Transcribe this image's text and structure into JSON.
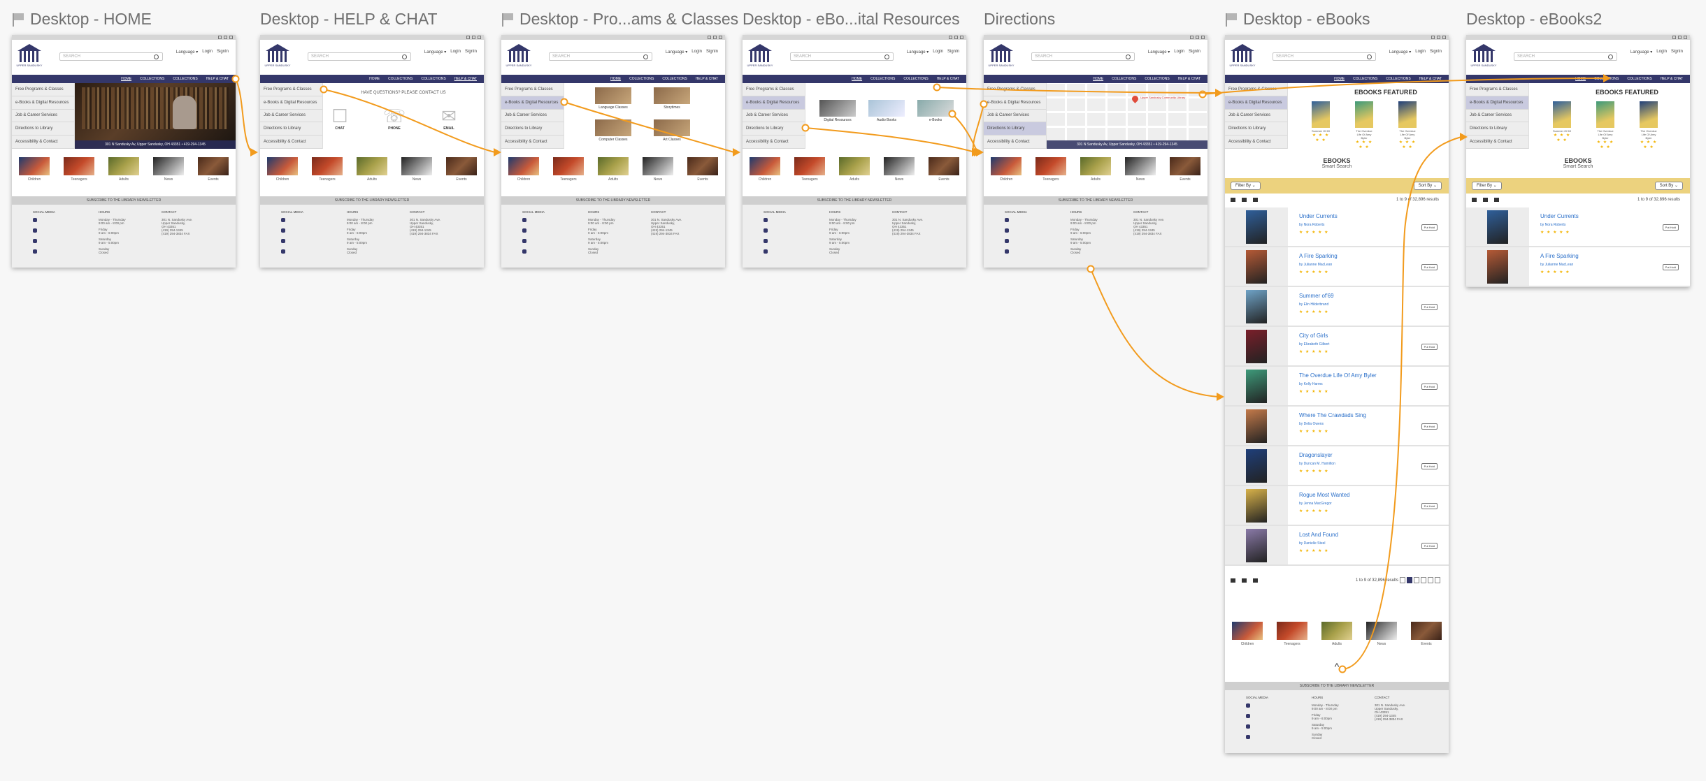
{
  "artboards": [
    {
      "title": "Desktop - HOME",
      "flag": true,
      "variant": "home",
      "active_nav": 0
    },
    {
      "title": "Desktop - HELP & CHAT",
      "flag": false,
      "variant": "help",
      "active_nav": 3
    },
    {
      "title": "Desktop - Pro...ams & Classes",
      "flag": true,
      "variant": "programs",
      "active_side": 1
    },
    {
      "title": "Desktop - eBo...ital Resources",
      "flag": false,
      "variant": "eresources",
      "active_side": 1
    },
    {
      "title": "Directions",
      "flag": false,
      "variant": "directions",
      "active_side": 3
    },
    {
      "title": "Desktop - eBooks",
      "flag": true,
      "variant": "ebooks",
      "active_side": 1
    },
    {
      "title": "Desktop - eBooks2",
      "flag": false,
      "variant": "ebooks2",
      "active_side": 1
    }
  ],
  "header": {
    "search_placeholder": "SEARCH",
    "language": "Language ▾",
    "login": "Login",
    "signin": "SignIn",
    "logo_text": "UPPER SANDUSKY"
  },
  "nav": [
    "HOME",
    "COLLECTIONS",
    "COLLECTIONS",
    "HELP & CHAT"
  ],
  "sidebar": [
    "Free Programs & Classes",
    "e-Books & Digital Resources",
    "Job & Career Services",
    "Directions to Library",
    "Accessibility & Contact"
  ],
  "address": "301 N Sandusky Av, Upper Sandusky, OH 43351 • 419-294-1345",
  "help": {
    "heading": "HAVE QUESTIONS? PLEASE CONTACT US",
    "options": [
      "CHAT",
      "PHONE",
      "EMAIL"
    ]
  },
  "programs": [
    "Language Classes",
    "Storytimes",
    "Computer Classes",
    "Art Classes"
  ],
  "eresources": [
    "Digital Resources",
    "Audio Books",
    "e-Books"
  ],
  "map_label": "Upper Sandusky Community Library",
  "categories": [
    "Children",
    "Teenagers",
    "Adults",
    "News",
    "Events"
  ],
  "subscribe": "SUBSCRIBE TO THE LIBRARY NEWSLETTER",
  "footer": {
    "social": "SOCIAL MEDIA",
    "hours": "HOURS",
    "contact": "CONTACT",
    "hours_lines": [
      "Monday - Thursday",
      "9:00 am - 8:00 pm",
      "Friday",
      "9 am - 6:00pm",
      "Saturday",
      "9 am - 5:00pm",
      "Sunday",
      "Closed"
    ],
    "contact_lines": [
      "301 N. Sandusky Ave.",
      "Upper Sandusky,",
      "OH 43351",
      "(419) 294-1345",
      "(419) 294-3834 FAX"
    ]
  },
  "ebooks": {
    "featured_heading": "EBOOKS FEATURED",
    "featured": [
      {
        "title": "Summer Of 69"
      },
      {
        "title": "The Overdue Life Of Amy Byler"
      },
      {
        "title": "The Overdue Life Of Amy Byler"
      }
    ],
    "smart_title": "EBOOKS",
    "smart_sub": "Smart Search",
    "filter_by": "Filter By ⌄",
    "sort_by": "Sort By ⌄",
    "results": "1 to 9 of 32,896 results",
    "hold": "Put Hold",
    "stars": "★ ★ ★ ★ ★",
    "books": [
      {
        "title": "Under Currents",
        "author": "by Nora Roberts",
        "color": "#2f5f9a"
      },
      {
        "title": "A Fire Sparking",
        "author": "by Julianne MacLean",
        "color": "#b55a36"
      },
      {
        "title": "Summer of'69",
        "author": "by Elin Hilderbrand",
        "color": "#6fa3c7"
      },
      {
        "title": "City of Girls",
        "author": "by Elizabeth Gilbert",
        "color": "#7a1f2a"
      },
      {
        "title": "The Overdue Life Of Amy Byler",
        "author": "by Kelly Harms",
        "color": "#3e9a7a"
      },
      {
        "title": "Where The Crawdads Sing",
        "author": "by Delia Owens",
        "color": "#c47a4a"
      },
      {
        "title": "Dragonslayer",
        "author": "by Duncan M. Hamilton",
        "color": "#1f3f7a"
      },
      {
        "title": "Rogue Most Wanted",
        "author": "by Jenna MacGregor",
        "color": "#d8b24a"
      },
      {
        "title": "Lost And Found",
        "author": "by Danielle Steel",
        "color": "#8a7aa8"
      }
    ]
  },
  "colors": {
    "primary": "#34376a",
    "flow": "#f29b1d",
    "filterbar": "#ecd27e",
    "link": "#2a6fc9"
  }
}
